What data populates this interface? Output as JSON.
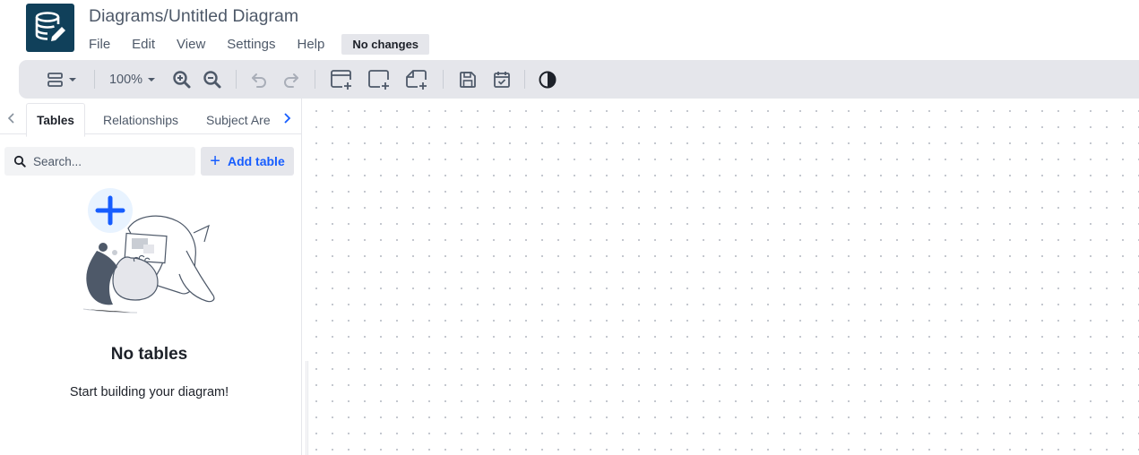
{
  "header": {
    "title": "Diagrams/Untitled Diagram",
    "logo_icon": "database-edit-icon",
    "status": "No changes"
  },
  "menu": [
    "File",
    "Edit",
    "View",
    "Settings",
    "Help"
  ],
  "toolbar": {
    "zoom_level": "100%",
    "icons": [
      "layout-menu-icon",
      "zoom-in-icon",
      "zoom-out-icon",
      "undo-icon",
      "redo-icon",
      "add-table-icon",
      "add-area-icon",
      "add-note-icon",
      "save-icon",
      "calendar-check-icon",
      "theme-toggle-icon"
    ]
  },
  "sidebar": {
    "tabs": [
      "Tables",
      "Relationships",
      "Subject Are"
    ],
    "active_tab": "Tables",
    "search": {
      "placeholder": "Search..."
    },
    "add_button": "Add table",
    "empty": {
      "title": "No tables",
      "subtitle": "Start building your diagram!"
    }
  },
  "colors": {
    "brand": "#10405a",
    "accent": "#165dff",
    "toolbar_bg": "#e5e6eb"
  }
}
